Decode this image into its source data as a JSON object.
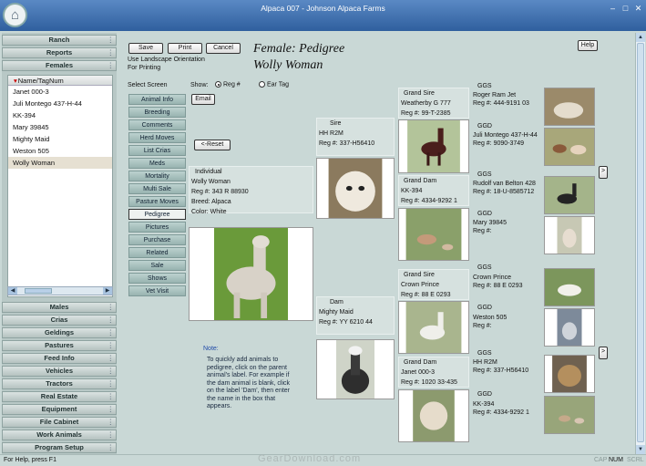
{
  "window": {
    "title": "Alpaca 007 - Johnson Alpaca Farms"
  },
  "window_controls": {
    "minimize": "–",
    "maximize": "□",
    "close": "✕"
  },
  "sidebar": {
    "top_nav": [
      "Ranch",
      "Reports"
    ],
    "active_section": "Females",
    "list_header": "Name/TagNum",
    "animals": [
      "Janet 000-3",
      "Juli Montego 437-H-44",
      "KK-394",
      "Mary 39845",
      "Mighty Maid",
      "Weston 505",
      "Wolly Woman"
    ],
    "selected_animal": "Wolly Woman",
    "bottom_nav": [
      "Males",
      "Crias",
      "Geldings",
      "Pastures",
      "Feed Info",
      "Vehicles",
      "Tractors",
      "Real Estate",
      "Equipment",
      "File Cabinet",
      "Work Animals",
      "Program Setup"
    ]
  },
  "toolbar": {
    "save": "Save",
    "print": "Print",
    "cancel": "Cancel",
    "help": "Help",
    "hint_line1": "Use Landscape Orientation",
    "hint_line2": "For Printing"
  },
  "header": {
    "title": "Female: Pedigree",
    "subtitle": "Wolly Woman"
  },
  "select_screen": {
    "label": "Select Screen",
    "items": [
      "Animal Info",
      "Breeding",
      "Comments",
      "Herd Moves",
      "List Crias",
      "Meds",
      "Mortality",
      "Multi Sale",
      "Pasture Moves",
      "Pedigree",
      "Pictures",
      "Purchase",
      "Related",
      "Sale",
      "Shows",
      "Vet Visit"
    ],
    "selected": "Pedigree"
  },
  "show": {
    "label": "Show:",
    "option_reg": "Reg #",
    "option_tag": "Ear Tag",
    "selected": "Reg #"
  },
  "email": "Email",
  "reset": "<-Reset",
  "individual": {
    "label": "Individual",
    "name": "Wolly Woman",
    "reg": "Reg #: 343 R 88930",
    "breed": "Breed: Alpaca",
    "color": "Color: White"
  },
  "sire": {
    "label": "Sire",
    "name": "HH R2M",
    "reg": "Reg #: 337-H56410"
  },
  "dam": {
    "label": "Dam",
    "name": "Mighty Maid",
    "reg": "Reg #: YY 6210 44"
  },
  "grand_sire_1": {
    "label": "Grand Sire",
    "name": "Weatherby G 777",
    "reg": "Reg #: 99-T-2385"
  },
  "grand_dam_1": {
    "label": "Grand Dam",
    "name": "KK-394",
    "reg": "Reg #: 4334-9292 1"
  },
  "grand_sire_2": {
    "label": "Grand Sire",
    "name": "Crown Prince",
    "reg": "Reg #: 88 E 0293"
  },
  "grand_dam_2": {
    "label": "Grand Dam",
    "name": "Janet 000-3",
    "reg": "Reg #: 1020 33-435"
  },
  "ggs_1": {
    "label": "GGS",
    "name": "Roger Ram Jet",
    "reg": "Reg #: 444-9191 03"
  },
  "ggd_1": {
    "label": "GGD",
    "name": "Juli Montego 437-H-44",
    "reg": "Reg #: 9090-3749"
  },
  "ggs_2": {
    "label": "GGS",
    "name": "Rudolf van Belton 428",
    "reg": "Reg #: 18-U-8585712"
  },
  "ggd_2": {
    "label": "GGD",
    "name": "Mary 39845",
    "reg": "Reg #:"
  },
  "ggs_3": {
    "label": "GGS",
    "name": "Crown Prince",
    "reg": "Reg #: 88 E 0293"
  },
  "ggd_3": {
    "label": "GGD",
    "name": "Weston 505",
    "reg": "Reg #:"
  },
  "ggs_4": {
    "label": "GGS",
    "name": "HH R2M",
    "reg": "Reg #: 337-H56410"
  },
  "ggd_4": {
    "label": "GGD",
    "name": "KK-394",
    "reg": "Reg #: 4334-9292 1"
  },
  "more_buttons": ">",
  "note": {
    "title": "Note:",
    "text": "To quickly add animals to pedigree, click on the parent animal's label. For example if the dam animal is blank, click on the label 'Dam', then enter the name in the box that appears."
  },
  "statusbar": {
    "left": "For Help, press F1",
    "watermark": "GearDownload.com",
    "cap": "CAP",
    "num": "NUM",
    "scrl": "SCRL"
  },
  "colors": {
    "titlebar": "#2f5f9e",
    "background": "#c9d8d6",
    "panel": "#d6e1df",
    "active_section": "#4d6f92"
  }
}
